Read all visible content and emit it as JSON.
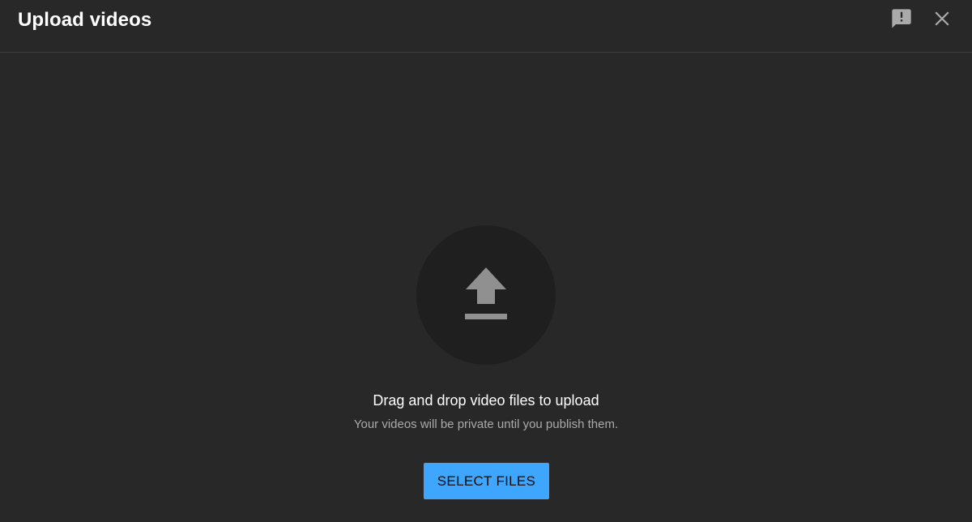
{
  "dialog": {
    "title": "Upload videos"
  },
  "header_icons": {
    "feedback": "feedback-icon",
    "close": "close-icon"
  },
  "dropzone": {
    "icon": "upload-arrow-icon",
    "primary_text": "Drag and drop video files to upload",
    "secondary_text": "Your videos will be private until you publish them.",
    "button_label": "SELECT FILES"
  },
  "colors": {
    "background": "#282828",
    "circle": "#1f1f1f",
    "accent": "#3ea6ff",
    "icon": "#909090",
    "secondary_text": "#aaaaaa"
  }
}
